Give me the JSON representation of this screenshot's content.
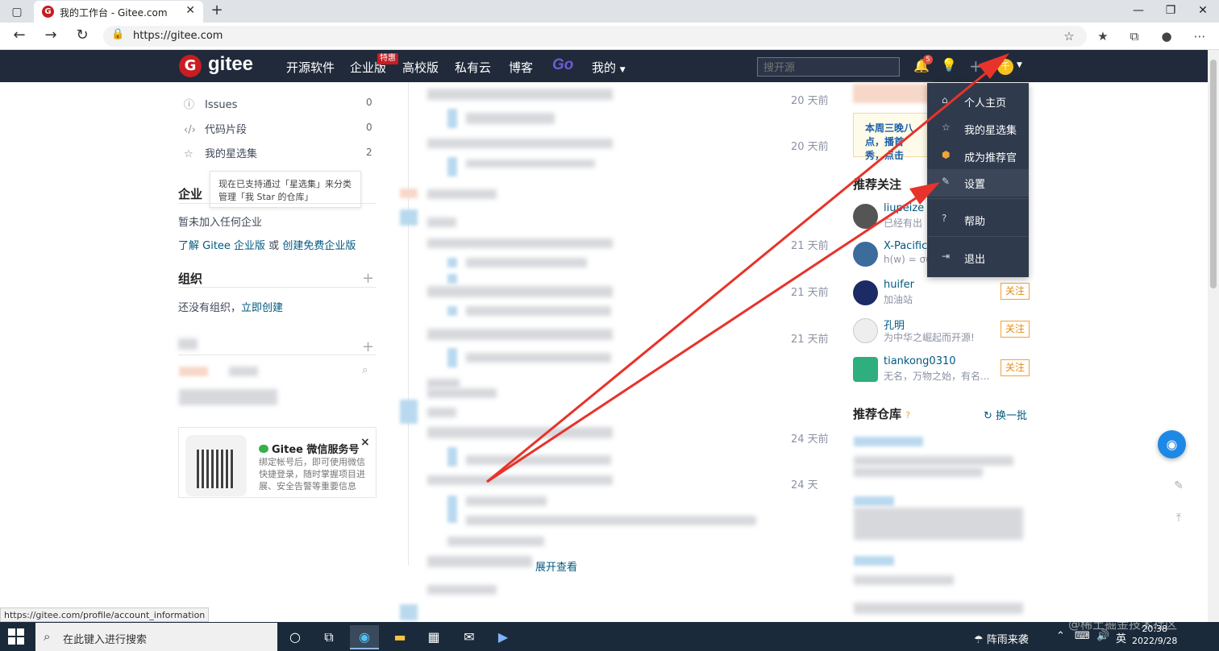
{
  "browser": {
    "tab_title": "我的工作台 - Gitee.com",
    "tab_favicon": "G",
    "url": "https://gitee.com",
    "status_url": "https://gitee.com/profile/account_information"
  },
  "header": {
    "logo_text": "gitee",
    "logo_mark": "G",
    "nav": [
      "开源软件",
      "企业版",
      "高校版",
      "私有云",
      "博客",
      "Go",
      "我的"
    ],
    "enterprise_badge": "特惠",
    "search_placeholder": "搜开源",
    "notification_count": "5",
    "avatar_letter": "千",
    "accent": "#c71d23"
  },
  "sidebar": {
    "items": [
      {
        "icon": "issue-icon",
        "label": "Issues",
        "count": "0"
      },
      {
        "icon": "code-icon",
        "label": "代码片段",
        "count": "0"
      },
      {
        "icon": "star-icon",
        "label": "我的星选集",
        "count": "2"
      }
    ],
    "tooltip": "现在已支持通过「星选集」来分类管理「我 Star 的仓库」",
    "enterprise_title": "企业",
    "enterprise_empty": "暂未加入任何企业",
    "enterprise_link1": "了解 Gitee 企业版",
    "enterprise_or": " 或 ",
    "enterprise_link2": "创建免费企业版",
    "org_title": "组织",
    "org_empty": "还没有组织，",
    "org_link": "立即创建"
  },
  "wechat": {
    "title": "Gitee 微信服务号",
    "desc": "绑定帐号后，即可使用微信快捷登录，随时掌握项目进展、安全告警等重要信息",
    "close": "×"
  },
  "feed": {
    "times": [
      "20 天前",
      "20 天前",
      "21 天前",
      "21 天前",
      "21 天前",
      "24 天前",
      "24 天"
    ],
    "more_link": "展开查看"
  },
  "right": {
    "banner": "本周三晚八点，播首秀，点击",
    "recommend_follow": "推荐关注",
    "users": [
      {
        "name": "liupeize",
        "desc": "已经有出",
        "avatar_color": "#555"
      },
      {
        "name": "X-Pacific",
        "desc": "h(w) = σ(",
        "avatar_color": "#3b6c9c"
      },
      {
        "name": "huifer",
        "desc": "加油站",
        "avatar_color": "#1c2a66"
      },
      {
        "name": "孔明",
        "desc": "为中华之崛起而开源!",
        "avatar_color": "#eeeeee"
      },
      {
        "name": "tiankong0310",
        "desc": "无名，万物之始，有名...",
        "avatar_color": "#2fae7e"
      }
    ],
    "follow_label": "关注",
    "recommend_repo": "推荐仓库",
    "repo_help": "?",
    "refresh": "换一批"
  },
  "dropdown": {
    "items": [
      {
        "icon": "home-icon",
        "label": "个人主页"
      },
      {
        "icon": "star-icon",
        "label": "我的星选集"
      },
      {
        "icon": "badge-icon",
        "label": "成为推荐官"
      },
      {
        "icon": "settings-icon",
        "label": "设置"
      },
      {
        "icon": "help-icon",
        "label": "帮助"
      },
      {
        "icon": "logout-icon",
        "label": "退出"
      }
    ],
    "active_index": 3
  },
  "taskbar": {
    "search": "在此键入进行搜索",
    "weather": "阵雨来袭",
    "ime": "英",
    "time": "20:38",
    "date": "2022/9/28"
  },
  "watermark": "@稀土掘金技术社区",
  "annotation_color": "#e8332a"
}
